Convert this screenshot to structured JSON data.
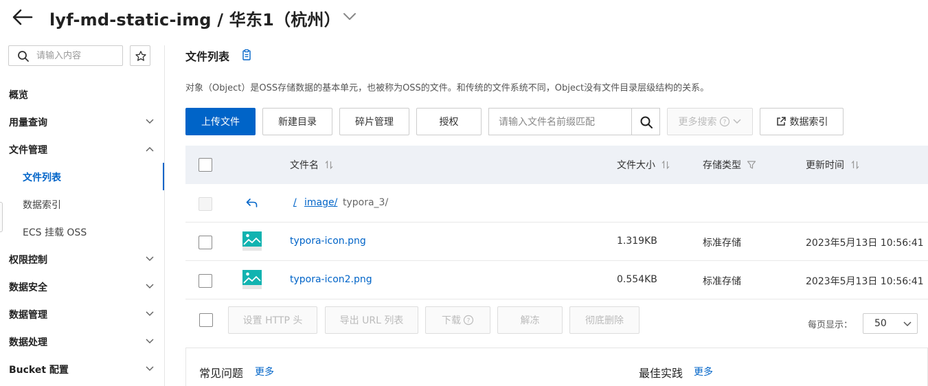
{
  "header": {
    "title": "lyf-md-static-img / 华东1（杭州）",
    "back_icon": "arrow-left-icon",
    "dropdown_icon": "chevron-down-icon"
  },
  "sidebar": {
    "search_placeholder": "请输入内容",
    "items": [
      {
        "label": "概览",
        "expandable": false
      },
      {
        "label": "用量查询",
        "expandable": true,
        "expanded": false
      },
      {
        "label": "文件管理",
        "expandable": true,
        "expanded": true
      },
      {
        "label": "文件列表",
        "sub": true,
        "active": true
      },
      {
        "label": "数据索引",
        "sub": true
      },
      {
        "label": "ECS 挂载 OSS",
        "sub": true
      },
      {
        "label": "权限控制",
        "expandable": true,
        "expanded": false
      },
      {
        "label": "数据安全",
        "expandable": true,
        "expanded": false
      },
      {
        "label": "数据管理",
        "expandable": true,
        "expanded": false
      },
      {
        "label": "数据处理",
        "expandable": true,
        "expanded": false
      },
      {
        "label": "Bucket 配置",
        "expandable": true,
        "expanded": false
      }
    ]
  },
  "main": {
    "section_title": "文件列表",
    "description": "对象（Object）是OSS存储数据的基本单元，也被称为OSS的文件。和传统的文件系统不同，Object没有文件目录层级结构的关系。",
    "toolbar": {
      "upload": "上传文件",
      "new_dir": "新建目录",
      "fragments": "碎片管理",
      "authorize": "授权",
      "search_placeholder": "请输入文件名前缀匹配",
      "more_search": "更多搜索",
      "data_index": "数据索引"
    },
    "table": {
      "headers": {
        "name": "文件名",
        "size": "文件大小",
        "storage": "存储类型",
        "updated": "更新时间"
      },
      "path": {
        "root": "/",
        "folder": "image/",
        "current": "typora_3/"
      },
      "rows": [
        {
          "name": "typora-icon.png",
          "size": "1.319KB",
          "storage": "标准存储",
          "updated": "2023年5月13日 10:56:41"
        },
        {
          "name": "typora-icon2.png",
          "size": "0.554KB",
          "storage": "标准存储",
          "updated": "2023年5月13日 10:56:41"
        }
      ]
    },
    "bulk_actions": {
      "http_header": "设置 HTTP 头",
      "export_url": "导出 URL 列表",
      "download": "下载",
      "unfreeze": "解冻",
      "delete_all": "彻底删除"
    },
    "pagination": {
      "per_page_label": "每页显示：",
      "per_page": "50"
    },
    "bottom": {
      "faq_title": "常见问题",
      "faq_more": "更多",
      "best_title": "最佳实践",
      "best_more": "更多"
    }
  },
  "colors": {
    "accent": "#0064c8",
    "table_header_bg": "#eef1f6"
  }
}
